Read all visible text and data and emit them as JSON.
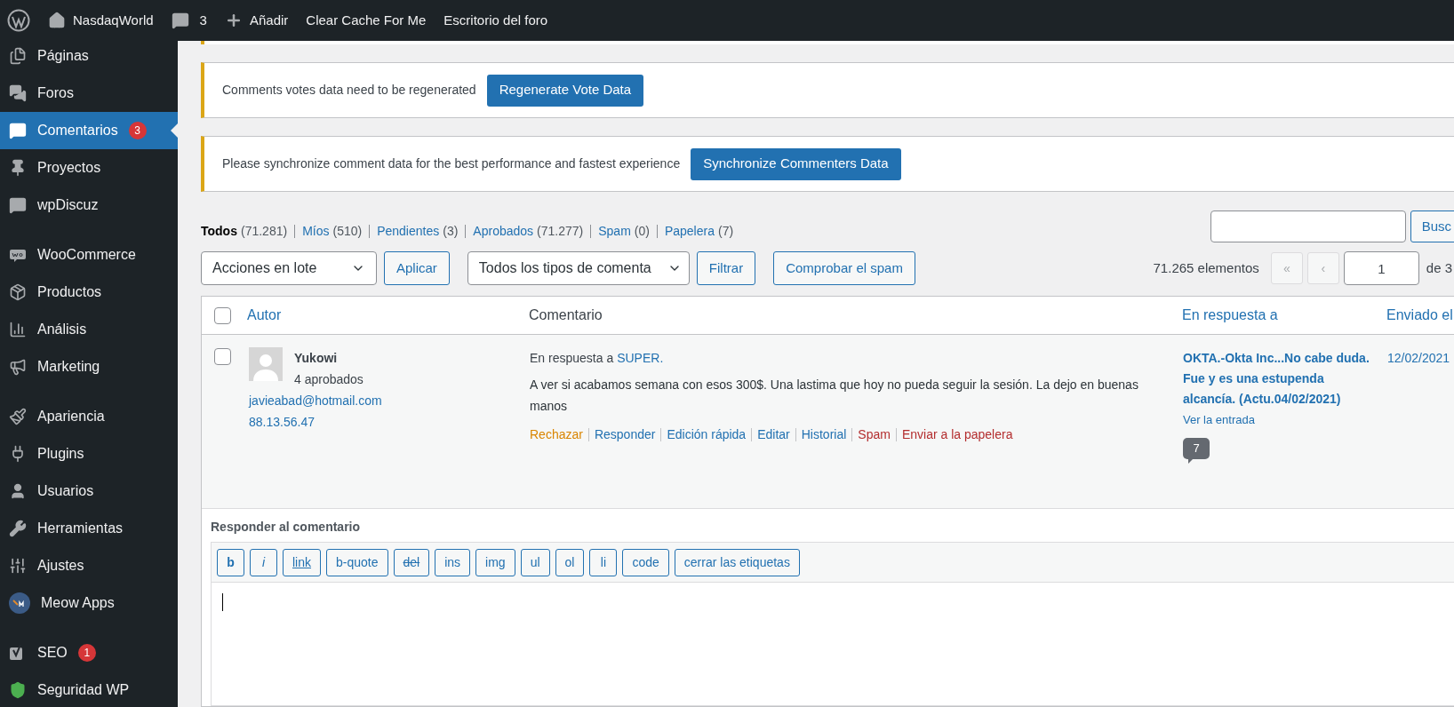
{
  "admin_bar": {
    "site": "NasdaqWorld",
    "comments_count": "3",
    "new": "Añadir",
    "items": [
      "Clear Cache For Me",
      "Escritorio del foro"
    ]
  },
  "sidebar": {
    "groups": [
      [
        {
          "kind": "pages",
          "label": "Páginas",
          "selected": false
        },
        {
          "kind": "forums",
          "label": "Foros",
          "selected": false
        },
        {
          "kind": "comments",
          "label": "Comentarios",
          "badge": "3",
          "selected": true
        },
        {
          "kind": "pin",
          "label": "Proyectos",
          "selected": false
        },
        {
          "kind": "bubble",
          "label": "wpDiscuz",
          "selected": false
        }
      ],
      [
        {
          "kind": "woo",
          "label": "WooCommerce",
          "selected": false
        },
        {
          "kind": "box",
          "label": "Productos",
          "selected": false
        },
        {
          "kind": "chart",
          "label": "Análisis",
          "selected": false
        },
        {
          "kind": "megaphone",
          "label": "Marketing",
          "selected": false
        }
      ],
      [
        {
          "kind": "brush",
          "label": "Apariencia",
          "selected": false
        },
        {
          "kind": "plug",
          "label": "Plugins",
          "selected": false
        },
        {
          "kind": "user",
          "label": "Usuarios",
          "selected": false
        },
        {
          "kind": "wrench",
          "label": "Herramientas",
          "selected": false
        },
        {
          "kind": "sliders",
          "label": "Ajustes",
          "selected": false
        },
        {
          "kind": "meow",
          "label": "Meow Apps",
          "selected": false
        }
      ],
      [
        {
          "kind": "yoast",
          "label": "SEO",
          "badge": "1",
          "selected": false
        },
        {
          "kind": "shield",
          "label": "Seguridad WP",
          "selected": false
        }
      ]
    ]
  },
  "notices": [
    {
      "text": "Comments votes data need to be regenerated",
      "button": "Regenerate Vote Data"
    },
    {
      "text": "Please synchronize comment data for the best performance and fastest experience",
      "button": "Synchronize Commenters Data"
    }
  ],
  "filters": [
    {
      "label": "Todos",
      "count": "(71.281)",
      "selected": true
    },
    {
      "label": "Míos",
      "count": "(510)",
      "selected": false
    },
    {
      "label": "Pendientes",
      "count": "(3)",
      "selected": false
    },
    {
      "label": "Aprobados",
      "count": "(71.277)",
      "selected": false
    },
    {
      "label": "Spam",
      "count": "(0)",
      "selected": false
    },
    {
      "label": "Papelera",
      "count": "(7)",
      "selected": false
    }
  ],
  "search": {
    "button": "Busc"
  },
  "toolbar": {
    "bulk_select": "Acciones en lote",
    "apply": "Aplicar",
    "type_select": "Todos los tipos de comenta",
    "filter": "Filtrar",
    "check_spam": "Comprobar el spam",
    "items_count": "71.265 elementos",
    "first": "«",
    "prev": "‹",
    "page": "1",
    "of": "de 3"
  },
  "table": {
    "select_all_checked": false,
    "columns": [
      "Autor",
      "Comentario",
      "En respuesta a",
      "Enviado el"
    ],
    "rows": [
      {
        "checked": false,
        "author": "Yukowi",
        "approved": "4 aprobados",
        "email": "javieabad@hotmail.com",
        "ip": "88.13.56.47",
        "in_reply_prefix": "En respuesta a",
        "in_reply_link": "SUPER.",
        "text": "A ver si acabamos semana con esos 300$. Una lastima que hoy no pueda seguir la sesión. La dejo en buenas manos",
        "actions": [
          {
            "kind": "unapprove",
            "label": "Rechazar"
          },
          {
            "kind": "link",
            "label": "Responder"
          },
          {
            "kind": "link",
            "label": "Edición rápida"
          },
          {
            "kind": "link",
            "label": "Editar"
          },
          {
            "kind": "link",
            "label": "Historial"
          },
          {
            "kind": "danger",
            "label": "Spam"
          },
          {
            "kind": "danger",
            "label": "Enviar a la papelera"
          }
        ],
        "post": "OKTA.-Okta Inc...No cabe duda. Fue y es una estupenda alcancía. (Actu.04/02/2021)",
        "view": "Ver la entrada",
        "comment_count": "7",
        "date": "12/02/2021"
      }
    ]
  },
  "reply": {
    "title": "Responder al comentario",
    "tags": [
      {
        "kind": "bold",
        "label": "b"
      },
      {
        "kind": "italic",
        "label": "i"
      },
      {
        "kind": "underline",
        "label": "link"
      },
      {
        "kind": "plain",
        "label": "b-quote"
      },
      {
        "kind": "strike",
        "label": "del"
      },
      {
        "kind": "plain",
        "label": "ins"
      },
      {
        "kind": "plain",
        "label": "img"
      },
      {
        "kind": "plain",
        "label": "ul"
      },
      {
        "kind": "plain",
        "label": "ol"
      },
      {
        "kind": "plain",
        "label": "li"
      },
      {
        "kind": "plain",
        "label": "code"
      },
      {
        "kind": "plain",
        "label": "cerrar las etiquetas"
      }
    ]
  }
}
